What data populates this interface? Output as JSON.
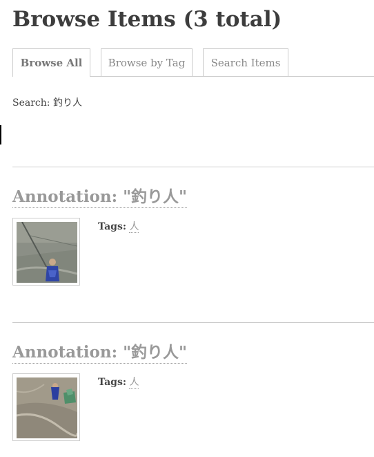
{
  "page": {
    "title": "Browse Items (3 total)"
  },
  "tabs": [
    {
      "label": "Browse All",
      "active": true
    },
    {
      "label": "Browse by Tag",
      "active": false
    },
    {
      "label": "Search Items",
      "active": false
    }
  ],
  "search": {
    "label": "Search:",
    "query": "釣り人"
  },
  "items": [
    {
      "title": "Annotation: \"釣り人\"",
      "tags_label": "Tags:",
      "tags": [
        "人"
      ]
    },
    {
      "title": "Annotation: \"釣り人\"",
      "tags_label": "Tags:",
      "tags": [
        "人"
      ]
    }
  ],
  "colors": {
    "text": "#444444",
    "muted_link": "#999999",
    "border": "#cccccc"
  }
}
